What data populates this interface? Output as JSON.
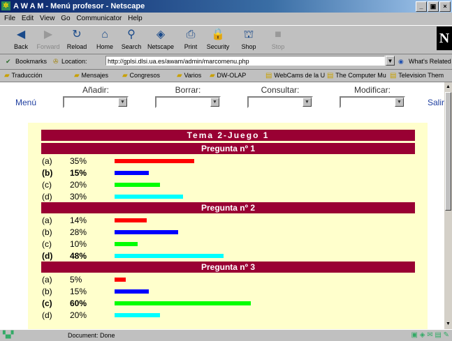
{
  "window": {
    "title": "A W A M - Menú profesor - Netscape",
    "controls": [
      "_",
      "▣",
      "×"
    ]
  },
  "menubar": [
    "File",
    "Edit",
    "View",
    "Go",
    "Communicator",
    "Help"
  ],
  "toolbar": [
    {
      "label": "Back",
      "icon": "back-arrow-icon",
      "glyph": "◀",
      "enabled": true
    },
    {
      "label": "Forward",
      "icon": "forward-arrow-icon",
      "glyph": "▶",
      "enabled": false
    },
    {
      "label": "Reload",
      "icon": "reload-icon",
      "glyph": "↻",
      "enabled": true
    },
    {
      "label": "Home",
      "icon": "home-icon",
      "glyph": "⌂",
      "enabled": true
    },
    {
      "label": "Search",
      "icon": "search-icon",
      "glyph": "⚲",
      "enabled": true
    },
    {
      "label": "Netscape",
      "icon": "netscape-icon",
      "glyph": "◈",
      "enabled": true
    },
    {
      "label": "Print",
      "icon": "print-icon",
      "glyph": "⎙",
      "enabled": true
    },
    {
      "label": "Security",
      "icon": "lock-icon",
      "glyph": "🔒",
      "enabled": true
    },
    {
      "label": "Shop",
      "icon": "shop-icon",
      "glyph": "⛫",
      "enabled": true
    },
    {
      "label": "Stop",
      "icon": "stop-icon",
      "glyph": "■",
      "enabled": false
    }
  ],
  "location": {
    "bookmarks_label": "Bookmarks",
    "location_label": "Location:",
    "url": "http://gplsi.dlsi.ua.es/awam/admin/marcomenu.php",
    "whats_related": "What's Related"
  },
  "bookmarks_bar": [
    "Traducción",
    "Mensajes",
    "Congresos",
    "Varios",
    "DW-OLAP",
    "WebCams de la U",
    "The Computer Mu",
    "Television Them"
  ],
  "nav": {
    "menu_link": "Menú",
    "exit_link": "Salir",
    "combos": [
      {
        "label": "Añadir:",
        "value": ""
      },
      {
        "label": "Borrar:",
        "value": ""
      },
      {
        "label": "Consultar:",
        "value": ""
      },
      {
        "label": "Modificar:",
        "value": ""
      }
    ]
  },
  "results": {
    "title": "Tema 2-Juego 1",
    "questions": [
      {
        "title": "Pregunta nº 1",
        "answers": [
          {
            "option": "(a)",
            "percent": "35%",
            "value": 35,
            "color": "#ff0000",
            "correct": false
          },
          {
            "option": "(b)",
            "percent": "15%",
            "value": 15,
            "color": "#0000ff",
            "correct": true
          },
          {
            "option": "(c)",
            "percent": "20%",
            "value": 20,
            "color": "#00ff00",
            "correct": false
          },
          {
            "option": "(d)",
            "percent": "30%",
            "value": 30,
            "color": "#00ffff",
            "correct": false
          }
        ]
      },
      {
        "title": "Pregunta nº 2",
        "answers": [
          {
            "option": "(a)",
            "percent": "14%",
            "value": 14,
            "color": "#ff0000",
            "correct": false
          },
          {
            "option": "(b)",
            "percent": "28%",
            "value": 28,
            "color": "#0000ff",
            "correct": false
          },
          {
            "option": "(c)",
            "percent": "10%",
            "value": 10,
            "color": "#00ff00",
            "correct": false
          },
          {
            "option": "(d)",
            "percent": "48%",
            "value": 48,
            "color": "#00ffff",
            "correct": true
          }
        ]
      },
      {
        "title": "Pregunta nº 3",
        "answers": [
          {
            "option": "(a)",
            "percent": "5%",
            "value": 5,
            "color": "#ff0000",
            "correct": false
          },
          {
            "option": "(b)",
            "percent": "15%",
            "value": 15,
            "color": "#0000ff",
            "correct": false
          },
          {
            "option": "(c)",
            "percent": "60%",
            "value": 60,
            "color": "#00ff00",
            "correct": true
          },
          {
            "option": "(d)",
            "percent": "20%",
            "value": 20,
            "color": "#00ffff",
            "correct": false
          }
        ]
      }
    ]
  },
  "status": {
    "text": "Document: Done"
  }
}
